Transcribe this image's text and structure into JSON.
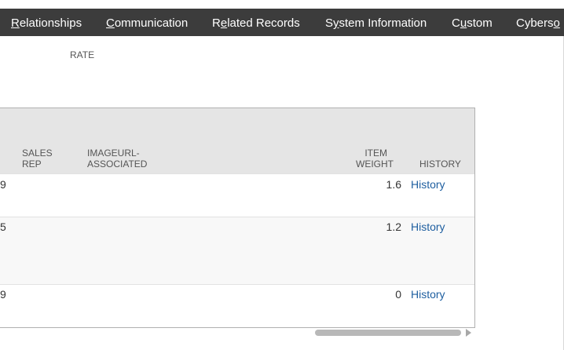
{
  "nav": {
    "tabs": [
      {
        "pre": "",
        "ul": "R",
        "post": "elationships"
      },
      {
        "pre": "",
        "ul": "C",
        "post": "ommunication"
      },
      {
        "pre": "R",
        "ul": "e",
        "post": "lated Records"
      },
      {
        "pre": "S",
        "ul": "y",
        "post": "stem Information"
      },
      {
        "pre": "C",
        "ul": "u",
        "post": "stom"
      },
      {
        "pre": "Cybers",
        "ul": "o",
        "post": ""
      }
    ]
  },
  "form": {
    "rate_label": "RATE"
  },
  "grid": {
    "headers": {
      "sales_rep_1": "SALES",
      "sales_rep_2": "REP",
      "imageurl_1": "IMAGEURL-",
      "imageurl_2": "ASSOCIATED",
      "weight_1": "ITEM",
      "weight_2": "WEIGHT",
      "history": "HISTORY"
    },
    "rows": [
      {
        "left": "9",
        "weight": "1.6",
        "history": "History"
      },
      {
        "left": "5",
        "weight": "1.2",
        "history": "History"
      },
      {
        "left": "9",
        "weight": "0",
        "history": "History"
      }
    ]
  }
}
